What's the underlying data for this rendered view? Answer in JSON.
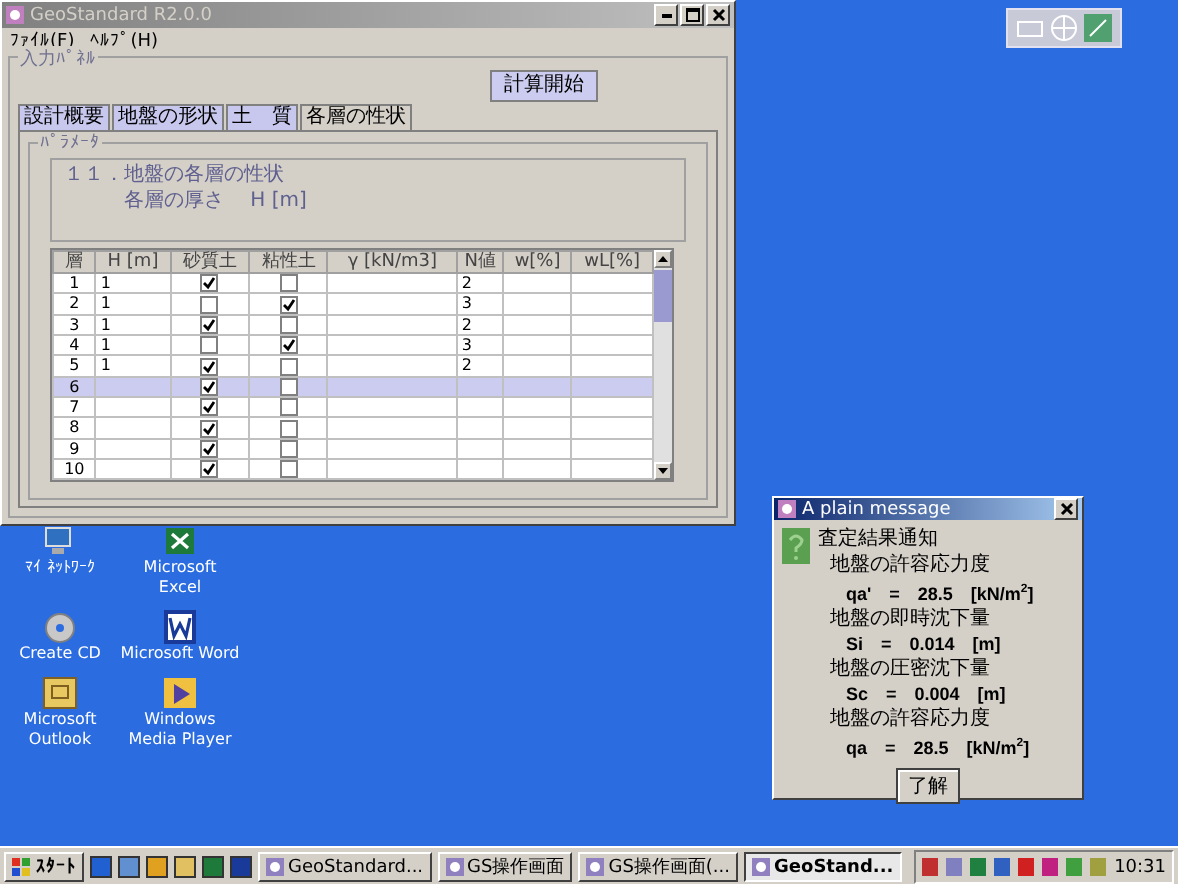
{
  "window": {
    "title": "GeoStandard R2.0.0",
    "menu": [
      "ﾌｧｲﾙ(F)",
      "ﾍﾙﾌﾟ(H)"
    ],
    "panel_title": "入力ﾊﾟﾈﾙ",
    "start_button": "計算開始",
    "tabs": [
      {
        "label": "設計概要",
        "selected": false
      },
      {
        "label": "地盤の形状",
        "selected": false
      },
      {
        "label": "土　質",
        "selected": false
      },
      {
        "label": "各層の性状",
        "selected": true
      }
    ],
    "group_title": "ﾊﾟﾗﾒｰﾀ",
    "note": [
      "１１．地盤の各層の性状",
      "各層の厚さ　 H [m]"
    ],
    "table": {
      "columns": [
        "層",
        "H [m]",
        "砂質土",
        "粘性土",
        "γ [kN/m3]",
        "N値",
        "w[%]",
        "wL[%]"
      ],
      "rows": [
        {
          "layer": "1",
          "h": "1",
          "sand": true,
          "clay": false,
          "n": "2",
          "selected": false
        },
        {
          "layer": "2",
          "h": "1",
          "sand": false,
          "clay": true,
          "n": "3",
          "selected": false
        },
        {
          "layer": "3",
          "h": "1",
          "sand": true,
          "clay": false,
          "n": "2",
          "selected": false
        },
        {
          "layer": "4",
          "h": "1",
          "sand": false,
          "clay": true,
          "n": "3",
          "selected": false
        },
        {
          "layer": "5",
          "h": "1",
          "sand": true,
          "clay": false,
          "n": "2",
          "selected": false
        },
        {
          "layer": "6",
          "h": "",
          "sand": true,
          "clay": false,
          "n": "",
          "selected": true
        },
        {
          "layer": "7",
          "h": "",
          "sand": true,
          "clay": false,
          "n": "",
          "selected": false
        },
        {
          "layer": "8",
          "h": "",
          "sand": true,
          "clay": false,
          "n": "",
          "selected": false
        },
        {
          "layer": "9",
          "h": "",
          "sand": true,
          "clay": false,
          "n": "",
          "selected": false
        },
        {
          "layer": "10",
          "h": "",
          "sand": true,
          "clay": false,
          "n": "",
          "selected": false
        }
      ]
    }
  },
  "dialog": {
    "title": "A plain message",
    "lines": [
      {
        "kind": "heading",
        "text": "査定結果通知"
      },
      {
        "kind": "label",
        "text": "地盤の許容応力度"
      },
      {
        "kind": "value",
        "text": "qa'　=　28.5　[kN/m$^{2}$]"
      },
      {
        "kind": "label",
        "text": "地盤の即時沈下量"
      },
      {
        "kind": "value",
        "text": "Si　=　0.014　[m]"
      },
      {
        "kind": "label",
        "text": "地盤の圧密沈下量"
      },
      {
        "kind": "value",
        "text": "Sc　=　0.004　[m]"
      },
      {
        "kind": "label",
        "text": "地盤の許容応力度"
      },
      {
        "kind": "value",
        "text": "qa　=　28.5　[kN/m$^{2}$]"
      }
    ],
    "ok_button": "了解"
  },
  "desktop_icons": [
    {
      "label": "ﾏｲ ﾈｯﾄﾜｰｸ",
      "kind": "network"
    },
    {
      "label": "Microsoft Excel",
      "kind": "excel"
    },
    {
      "label": "Create CD",
      "kind": "cd"
    },
    {
      "label": "Microsoft Word",
      "kind": "word"
    },
    {
      "label": "Microsoft Outlook",
      "kind": "outlook"
    },
    {
      "label": "Windows Media Player",
      "kind": "media"
    }
  ],
  "taskbar": {
    "start": "ｽﾀｰﾄ",
    "tasks": [
      {
        "label": "GeoStandard...",
        "selected": false
      },
      {
        "label": "GS操作画面",
        "selected": false
      },
      {
        "label": "GS操作画面(...",
        "selected": false
      },
      {
        "label": "GeoStand...",
        "selected": true
      }
    ],
    "clock": "10:31"
  }
}
